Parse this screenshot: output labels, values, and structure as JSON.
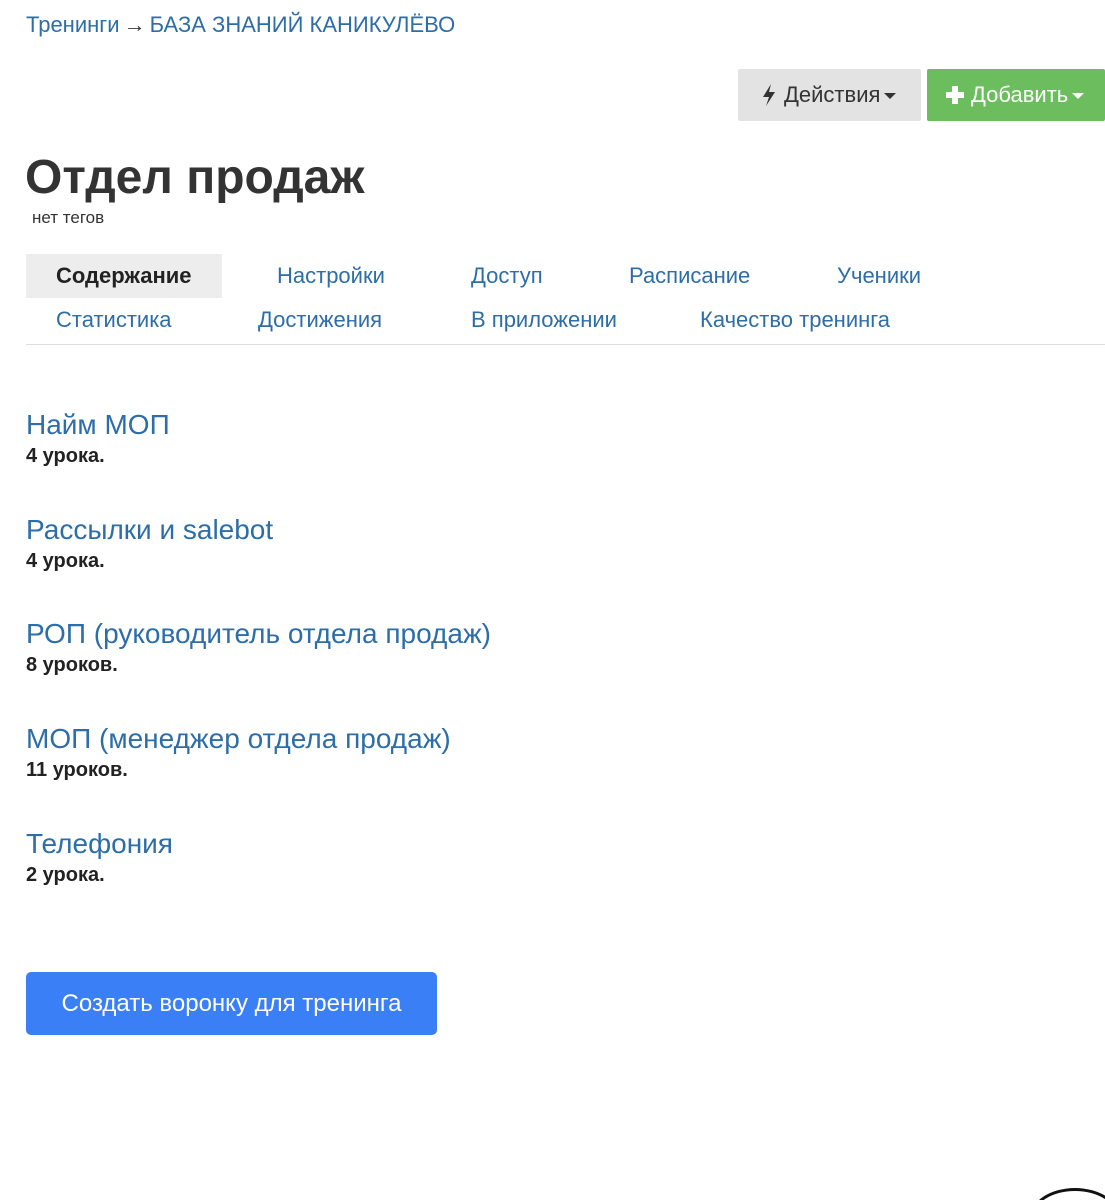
{
  "breadcrumb": {
    "root": "Тренинги",
    "separator": "→",
    "current": "БАЗА ЗНАНИЙ КАНИКУЛЁВО"
  },
  "toolbar": {
    "actions_label": "Действия",
    "actions_icon": "bolt-icon",
    "add_label": "Добавить",
    "add_icon": "plus-icon",
    "add_color": "#6cbd5e"
  },
  "page": {
    "title": "Отдел продаж",
    "tags": "нет тегов"
  },
  "tabs": {
    "row1": [
      "Содержание",
      "Настройки",
      "Доступ",
      "Расписание",
      "Ученики"
    ],
    "row2": [
      "Статистика",
      "Достижения",
      "В приложении",
      "Качество тренинга"
    ],
    "active": "Содержание"
  },
  "lessons": [
    {
      "title": "Найм МОП",
      "count": "4 урока."
    },
    {
      "title": "Рассылки и salebot",
      "count": "4 урока."
    },
    {
      "title": "РОП (руководитель отдела продаж)",
      "count": "8 уроков."
    },
    {
      "title": "МОП (менеджер отдела продаж)",
      "count": "11 уроков."
    },
    {
      "title": "Телефония",
      "count": "2 урока."
    }
  ],
  "funnel_button": {
    "label": "Создать воронку для тренинга",
    "color": "#3a7ff6"
  },
  "colors": {
    "link": "#2d6da8",
    "text": "#333333"
  }
}
